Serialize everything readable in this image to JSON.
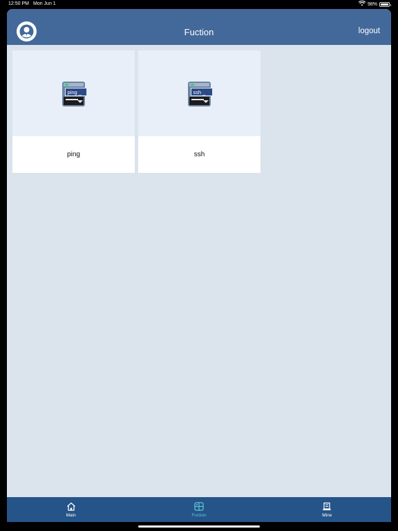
{
  "status_bar": {
    "time": "12:50 PM",
    "date": "Mon Jun 1",
    "battery": "98%",
    "battery_level": 0.98
  },
  "navbar": {
    "title": "Fuction",
    "logout_label": "logout",
    "avatar_icon": "user-avatar-icon"
  },
  "cards": [
    {
      "name": "ping",
      "icon_label": "ping _",
      "icon": "terminal-icon"
    },
    {
      "name": "ssh",
      "icon_label": "ssh _",
      "icon": "terminal-icon"
    }
  ],
  "tabbar": {
    "tabs": [
      {
        "label": "Main",
        "icon": "home-icon",
        "active": false
      },
      {
        "label": "Fuction",
        "icon": "function-icon",
        "active": true
      },
      {
        "label": "Mine",
        "icon": "profile-icon",
        "active": false
      }
    ],
    "active_color": "#5bc7d0"
  },
  "colors": {
    "navbar": "#43699a",
    "tabbar": "#255489",
    "background": "#dbe3ec"
  }
}
